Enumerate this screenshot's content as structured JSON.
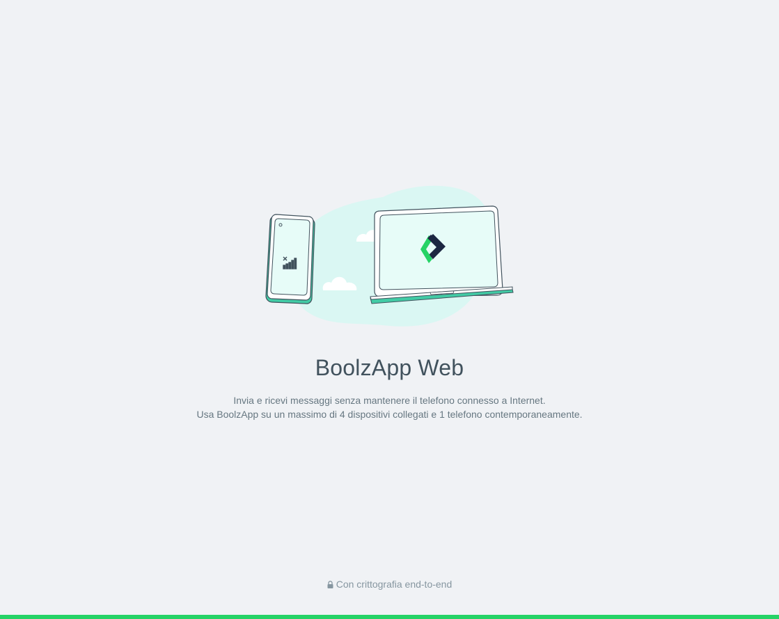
{
  "intro": {
    "title": "BoolzApp Web",
    "description_line1": "Invia e ricevi messaggi senza mantenere il telefono connesso a Internet.",
    "description_line2": "Usa BoolzApp su un massimo di 4 dispositivi collegati e 1 telefono contemporaneamente.",
    "footer_text": "Con crittografia end-to-end",
    "footer_icon": "lock-icon",
    "illustration_icons": [
      "phone-icon",
      "laptop-icon",
      "cloud-icon",
      "signal-icon",
      "app-logo-icon"
    ]
  },
  "colors": {
    "background": "#f0f2f5",
    "accent": "#25d366",
    "illustration_blob": "#daf7f3",
    "device_outline": "#41525d",
    "device_base": "#42cba5",
    "logo_green": "#25d366",
    "logo_dark": "#1c2742"
  }
}
